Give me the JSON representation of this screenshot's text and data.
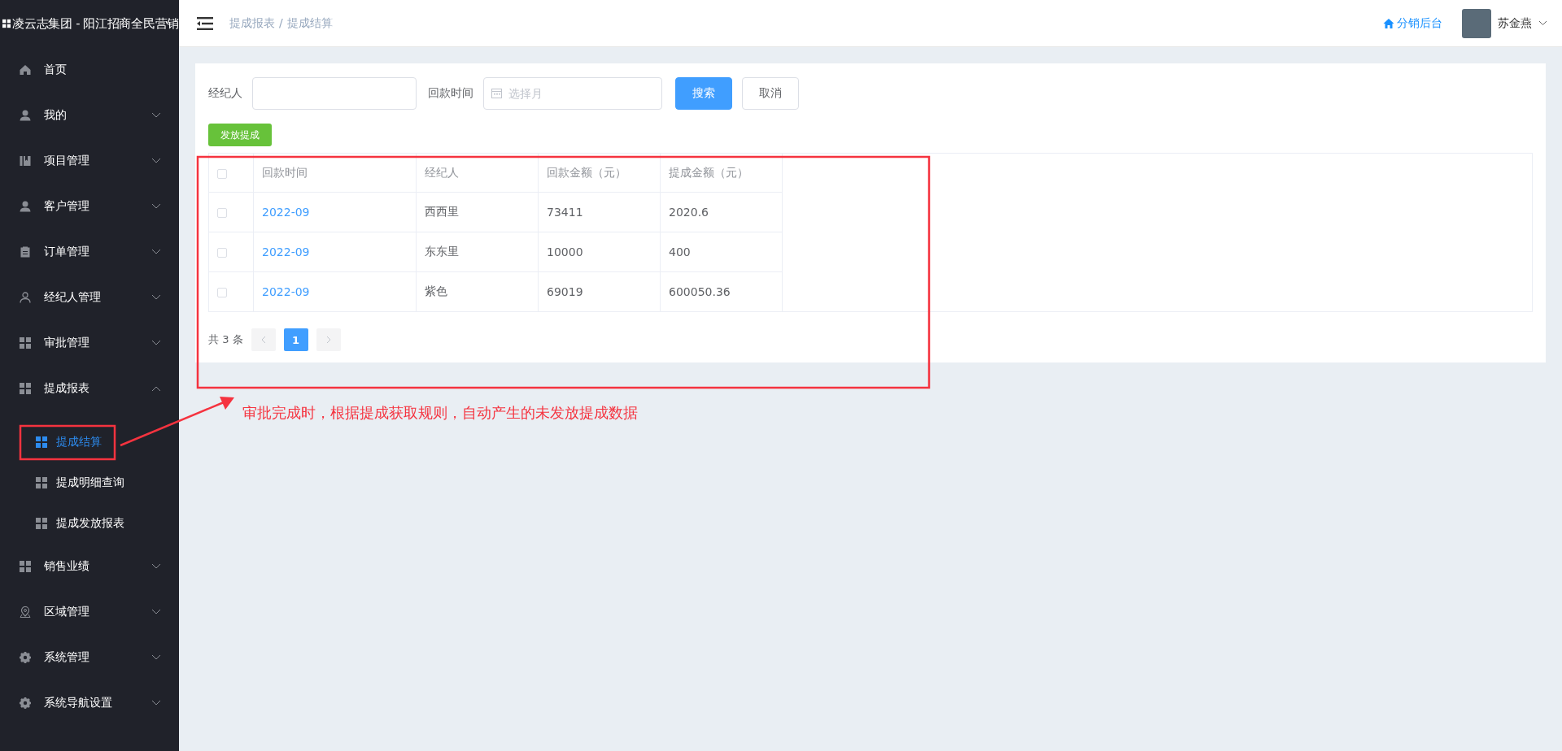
{
  "sidebar": {
    "title": "凌云志集团 - 阳江招商全民营销",
    "items": [
      {
        "label": "首页"
      },
      {
        "label": "我的",
        "expanded": false
      },
      {
        "label": "项目管理",
        "expanded": false
      },
      {
        "label": "客户管理",
        "expanded": false
      },
      {
        "label": "订单管理",
        "expanded": false
      },
      {
        "label": "经纪人管理",
        "expanded": false
      },
      {
        "label": "审批管理",
        "expanded": false
      },
      {
        "label": "提成报表",
        "expanded": true,
        "children": [
          {
            "label": "提成结算",
            "selected": true
          },
          {
            "label": "提成明细查询",
            "selected": false
          },
          {
            "label": "提成发放报表",
            "selected": false
          }
        ]
      },
      {
        "label": "销售业绩",
        "expanded": false
      },
      {
        "label": "区域管理",
        "expanded": false
      },
      {
        "label": "系统管理",
        "expanded": false
      },
      {
        "label": "系统导航设置",
        "expanded": false
      }
    ]
  },
  "header": {
    "breadcrumb": [
      "提成报表",
      "提成结算"
    ],
    "separator": "/",
    "backend_link": "分销后台",
    "user_name": "苏金燕"
  },
  "filters": {
    "agent_label": "经纪人",
    "time_label": "回款时间",
    "time_placeholder": "选择月",
    "search_button": "搜索",
    "cancel_button": "取消"
  },
  "issue_button": "发放提成",
  "table": {
    "header_checked": false,
    "columns": [
      "回款时间",
      "经纪人",
      "回款金额（元）",
      "提成金额（元）"
    ],
    "rows": [
      {
        "checked": false,
        "cells": [
          "2022-09",
          "西西里",
          "73411",
          "2020.6"
        ]
      },
      {
        "checked": false,
        "cells": [
          "2022-09",
          "东东里",
          "10000",
          "400"
        ]
      },
      {
        "checked": false,
        "cells": [
          "2022-09",
          "紫色",
          "69019",
          "600050.36"
        ]
      }
    ]
  },
  "pagination": {
    "total": "共 3 条",
    "pages": [
      {
        "label": "1",
        "selected": true
      }
    ]
  },
  "annotation": {
    "text": "审批完成时，根据提成获取规则，自动产生的未发放提成数据"
  }
}
